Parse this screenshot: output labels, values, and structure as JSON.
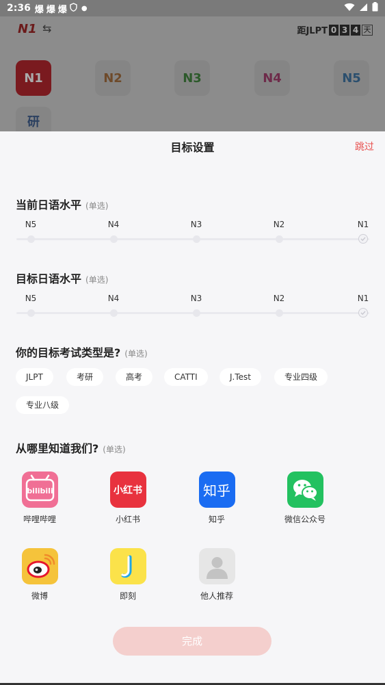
{
  "status_bar": {
    "time": "2:36",
    "notifications": [
      "爆",
      "爆",
      "爆"
    ]
  },
  "background_app": {
    "logo": "N1",
    "switch_icon": "⇆",
    "countdown_prefix": "距JLPT",
    "countdown_digits": [
      "0",
      "3",
      "4"
    ],
    "countdown_suffix": "天",
    "levels": [
      "N1",
      "N2",
      "N3",
      "N4",
      "N5"
    ],
    "level_colors": [
      "#c8323a",
      "#c9762b",
      "#3d8a3a",
      "#c73b74",
      "#3f7db8"
    ],
    "extra_card": "研"
  },
  "sheet": {
    "title": "目标设置",
    "skip": "跳过",
    "current_level": {
      "title": "当前日语水平",
      "hint": "(单选)",
      "labels": [
        "N5",
        "N4",
        "N3",
        "N2",
        "N1"
      ]
    },
    "target_level": {
      "title": "目标日语水平",
      "hint": "(单选)",
      "labels": [
        "N5",
        "N4",
        "N3",
        "N2",
        "N1"
      ]
    },
    "exam_type": {
      "title": "你的目标考试类型是?",
      "hint": "(单选)",
      "options": [
        "JLPT",
        "考研",
        "高考",
        "CATTI",
        "J.Test",
        "专业四级",
        "专业八级"
      ]
    },
    "source": {
      "title": "从哪里知道我们?",
      "hint": "(单选)",
      "options": [
        {
          "label": "哔哩哔哩",
          "icon": "bilibili-icon",
          "color": "#f06f95",
          "icon_text": "bilibili"
        },
        {
          "label": "小红书",
          "icon": "xiaohongshu-icon",
          "color": "#e8323e",
          "icon_text": "小红书"
        },
        {
          "label": "知乎",
          "icon": "zhihu-icon",
          "color": "#1a6cf2",
          "icon_text": "知乎"
        },
        {
          "label": "微信公众号",
          "icon": "wechat-icon",
          "color": "#23c160",
          "icon_text": ""
        },
        {
          "label": "微博",
          "icon": "weibo-icon",
          "color": "#f5c33b",
          "icon_text": ""
        },
        {
          "label": "即刻",
          "icon": "jike-icon",
          "color": "#fbe24a",
          "icon_text": "J"
        },
        {
          "label": "他人推荐",
          "icon": "person-icon",
          "color": "#e6e6e6",
          "icon_text": ""
        }
      ]
    },
    "done_button": "完成"
  }
}
